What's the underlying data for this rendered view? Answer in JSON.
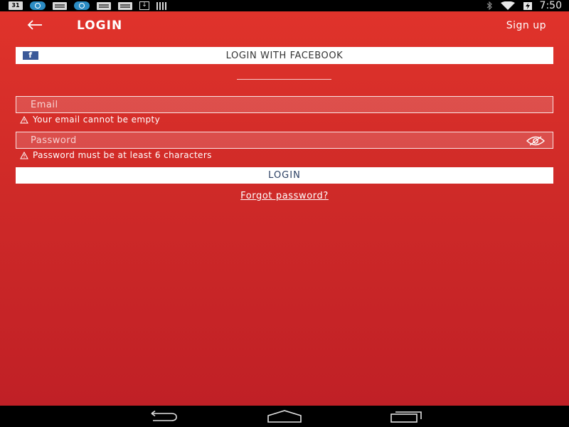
{
  "status_bar": {
    "calendar_day": "31",
    "time": "7:50",
    "left_icons": [
      "calendar-icon",
      "sync-icon",
      "mail-icon",
      "sync-icon",
      "mail-icon",
      "mail-icon",
      "download-icon",
      "barcode-icon"
    ],
    "right_icons": [
      "bluetooth-icon",
      "wifi-icon",
      "battery-icon"
    ]
  },
  "header": {
    "title": "LOGIN",
    "signup_label": "Sign up"
  },
  "facebook": {
    "label": "LOGIN WITH FACEBOOK",
    "icon_letter": "f"
  },
  "email": {
    "placeholder": "Email",
    "value": "",
    "error": "Your email cannot be empty"
  },
  "password": {
    "placeholder": "Password",
    "value": "",
    "error": "Password must be at least 6 characters"
  },
  "login_button": "LOGIN",
  "forgot_password": "Forgot password?",
  "colors": {
    "background_top": "#e0332b",
    "background_bottom": "#c02026",
    "facebook_blue": "#3b5998",
    "login_text": "#2a3f63"
  }
}
